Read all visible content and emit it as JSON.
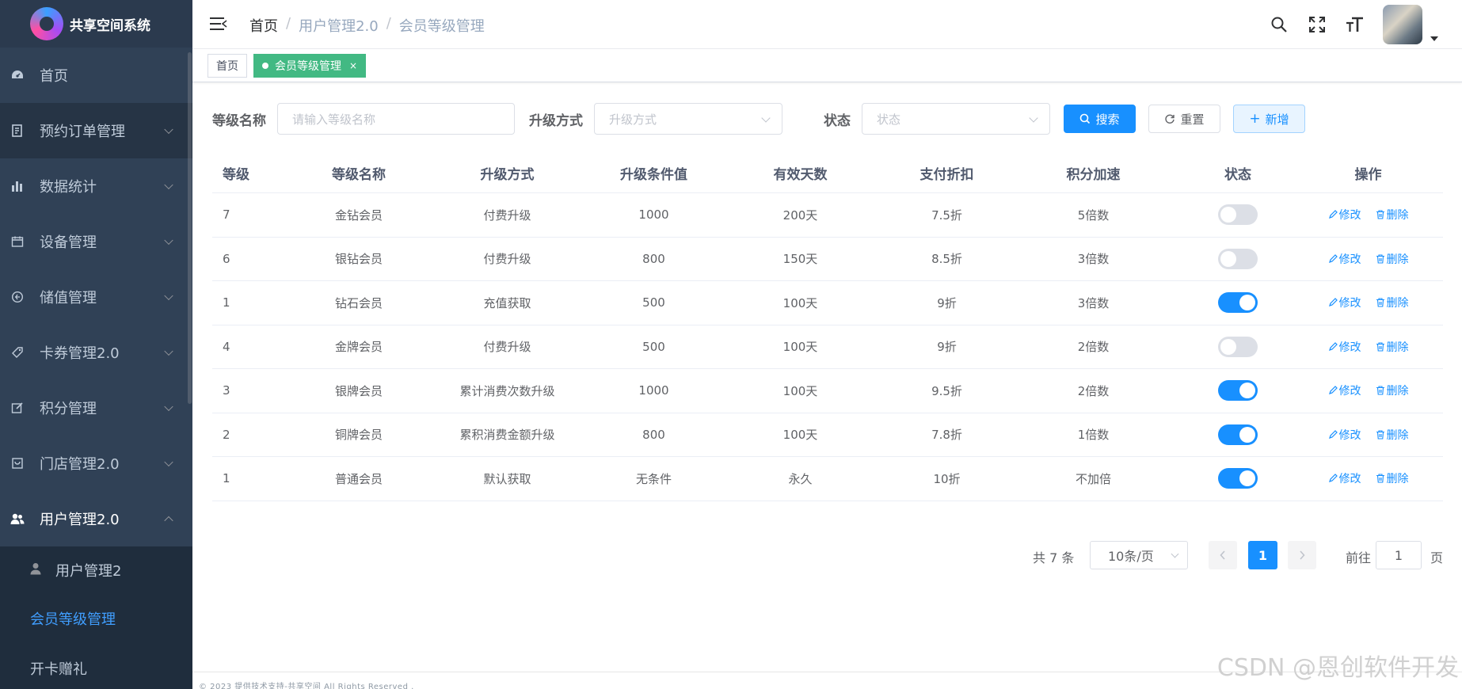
{
  "app": {
    "title": "共享空间系统"
  },
  "sidebar": {
    "items": [
      {
        "label": "首页",
        "icon": "dashboard-icon"
      },
      {
        "label": "预约订单管理",
        "icon": "order-icon"
      },
      {
        "label": "数据统计",
        "icon": "chart-icon"
      },
      {
        "label": "设备管理",
        "icon": "device-icon"
      },
      {
        "label": "储值管理",
        "icon": "wallet-icon"
      },
      {
        "label": "卡券管理2.0",
        "icon": "coupon-icon"
      },
      {
        "label": "积分管理",
        "icon": "edit-icon"
      },
      {
        "label": "门店管理2.0",
        "icon": "store-icon"
      },
      {
        "label": "用户管理2.0",
        "icon": "users-icon"
      }
    ],
    "sub_items": [
      {
        "label": "用户管理2",
        "icon": "user-icon"
      },
      {
        "label": "会员等级管理"
      },
      {
        "label": "开卡赠礼"
      }
    ]
  },
  "header": {
    "breadcrumb": [
      "首页",
      "用户管理2.0",
      "会员等级管理"
    ]
  },
  "tags": {
    "home": "首页",
    "active": "会员等级管理"
  },
  "search": {
    "level_name_label": "等级名称",
    "level_name_placeholder": "请输入等级名称",
    "upgrade_label": "升级方式",
    "upgrade_placeholder": "升级方式",
    "status_label": "状态",
    "status_placeholder": "状态",
    "search_btn": "搜索",
    "reset_btn": "重置",
    "add_btn": "新增"
  },
  "table": {
    "columns": [
      "等级",
      "等级名称",
      "升级方式",
      "升级条件值",
      "有效天数",
      "支付折扣",
      "积分加速",
      "状态",
      "操作"
    ],
    "edit_label": "修改",
    "delete_label": "删除",
    "rows": [
      {
        "level": "7",
        "name": "金钻会员",
        "upgrade": "付费升级",
        "cond": "1000",
        "days": "200天",
        "discount": "7.5折",
        "accel": "5倍数",
        "status": false
      },
      {
        "level": "6",
        "name": "银钻会员",
        "upgrade": "付费升级",
        "cond": "800",
        "days": "150天",
        "discount": "8.5折",
        "accel": "3倍数",
        "status": false
      },
      {
        "level": "1",
        "name": "钻石会员",
        "upgrade": "充值获取",
        "cond": "500",
        "days": "100天",
        "discount": "9折",
        "accel": "3倍数",
        "status": true
      },
      {
        "level": "4",
        "name": "金牌会员",
        "upgrade": "付费升级",
        "cond": "500",
        "days": "100天",
        "discount": "9折",
        "accel": "2倍数",
        "status": false
      },
      {
        "level": "3",
        "name": "银牌会员",
        "upgrade": "累计消费次数升级",
        "cond": "1000",
        "days": "100天",
        "discount": "9.5折",
        "accel": "2倍数",
        "status": true
      },
      {
        "level": "2",
        "name": "铜牌会员",
        "upgrade": "累积消费金额升级",
        "cond": "800",
        "days": "100天",
        "discount": "7.8折",
        "accel": "1倍数",
        "status": true
      },
      {
        "level": "1",
        "name": "普通会员",
        "upgrade": "默认获取",
        "cond": "无条件",
        "days": "永久",
        "discount": "10折",
        "accel": "不加倍",
        "status": true
      }
    ]
  },
  "pagination": {
    "total": "共 7 条",
    "page_size": "10条/页",
    "current": "1",
    "goto_label": "前往",
    "goto_value": "1",
    "page_unit": "页"
  },
  "footer": {
    "text": "© 2023 提供技术支持-共享空间 All Rights Reserved ."
  },
  "watermark": "CSDN @恩创软件开发",
  "colors": {
    "sidebar_bg": "#304156",
    "primary": "#1890ff",
    "tag_active": "#42b983"
  }
}
